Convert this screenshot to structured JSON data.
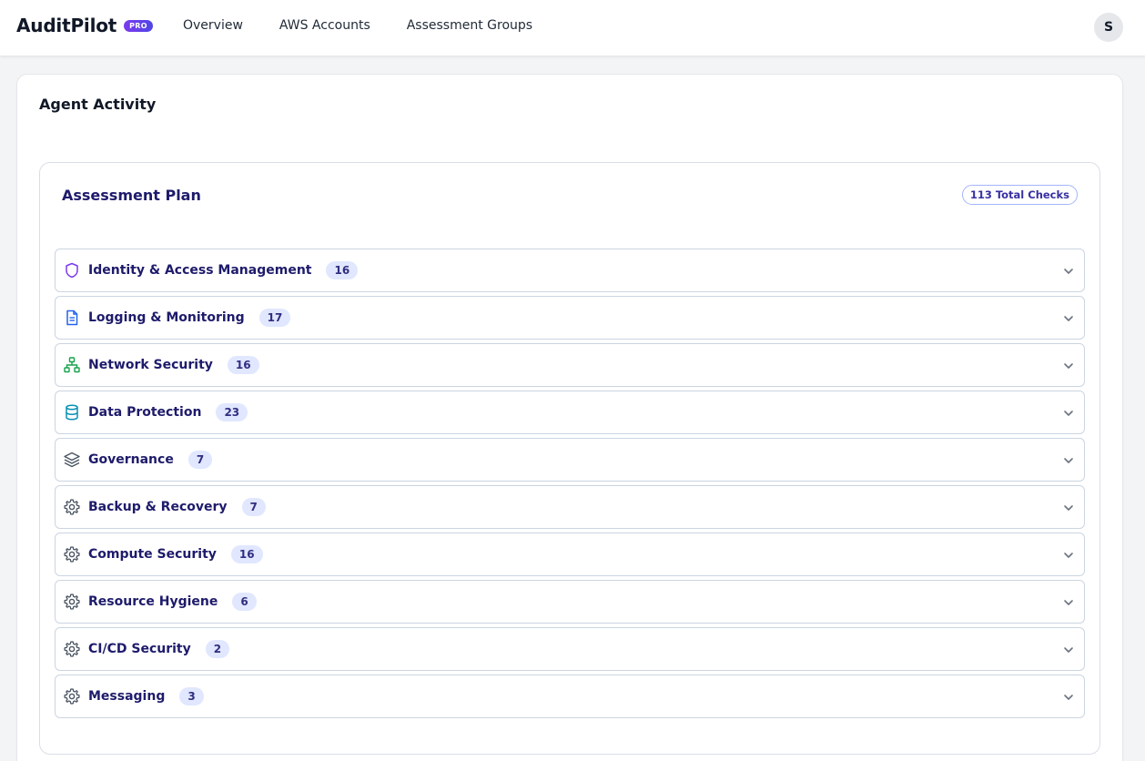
{
  "brand": {
    "name": "AuditPilot",
    "badge": "PRO"
  },
  "nav": {
    "items": [
      "Overview",
      "AWS Accounts",
      "Assessment Groups"
    ]
  },
  "user": {
    "initial": "S"
  },
  "page": {
    "title": "Agent Activity"
  },
  "plan": {
    "title": "Assessment Plan",
    "total": "113 Total Checks",
    "categories": [
      {
        "label": "Identity & Access Management",
        "count": "16",
        "icon": "shield-icon",
        "color": "#7c3aed"
      },
      {
        "label": "Logging & Monitoring",
        "count": "17",
        "icon": "document-icon",
        "color": "#2563eb"
      },
      {
        "label": "Network Security",
        "count": "16",
        "icon": "network-icon",
        "color": "#16a34a"
      },
      {
        "label": "Data Protection",
        "count": "23",
        "icon": "database-icon",
        "color": "#0891b2"
      },
      {
        "label": "Governance",
        "count": "7",
        "icon": "layers-icon",
        "color": "#4b5563"
      },
      {
        "label": "Backup & Recovery",
        "count": "7",
        "icon": "gear-icon",
        "color": "#4b5563"
      },
      {
        "label": "Compute Security",
        "count": "16",
        "icon": "gear-icon",
        "color": "#4b5563"
      },
      {
        "label": "Resource Hygiene",
        "count": "6",
        "icon": "gear-icon",
        "color": "#4b5563"
      },
      {
        "label": "CI/CD Security",
        "count": "2",
        "icon": "gear-icon",
        "color": "#4b5563"
      },
      {
        "label": "Messaging",
        "count": "3",
        "icon": "gear-icon",
        "color": "#4b5563"
      }
    ]
  }
}
